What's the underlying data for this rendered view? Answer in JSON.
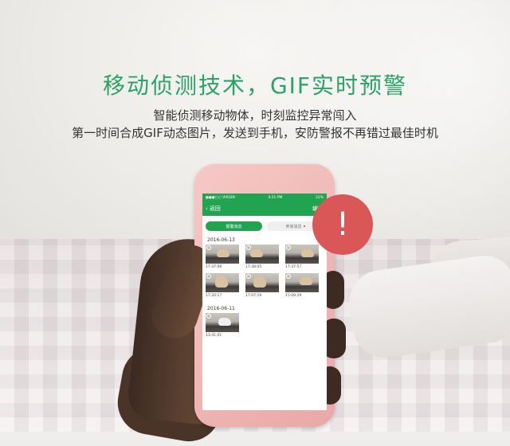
{
  "headline": "移动侦测技术，GIF实时预警",
  "subline1": "智能侦测移动物体，时刻监控异常闯入",
  "subline2": "第一时间合成GIF动态图片，发送到手机，安防警报不再错过最佳时机",
  "badge_symbol": "!",
  "colors": {
    "accent": "#22a34f",
    "badge": "#d95757",
    "headline": "#2aa364"
  },
  "phone": {
    "statusbar": {
      "carrier": "●●●○○ VIRGIN",
      "time": "4:21 PM",
      "battery": "22%"
    },
    "navbar": {
      "back_label": "返回",
      "right_label": "编辑"
    },
    "tabs": [
      {
        "label": "报警消息",
        "active": true
      },
      {
        "label": "养家消息",
        "active": false
      }
    ],
    "groups": [
      {
        "date": "2016-06-13",
        "items": [
          {
            "time": "17:37:06"
          },
          {
            "time": "17:38:05"
          },
          {
            "time": "17:37:57"
          },
          {
            "time": "17:20:17"
          },
          {
            "time": "17:07:19"
          },
          {
            "time": "15:09:29"
          }
        ]
      },
      {
        "date": "2016-06-11",
        "items": [
          {
            "time": "13:41:01"
          }
        ]
      }
    ]
  }
}
